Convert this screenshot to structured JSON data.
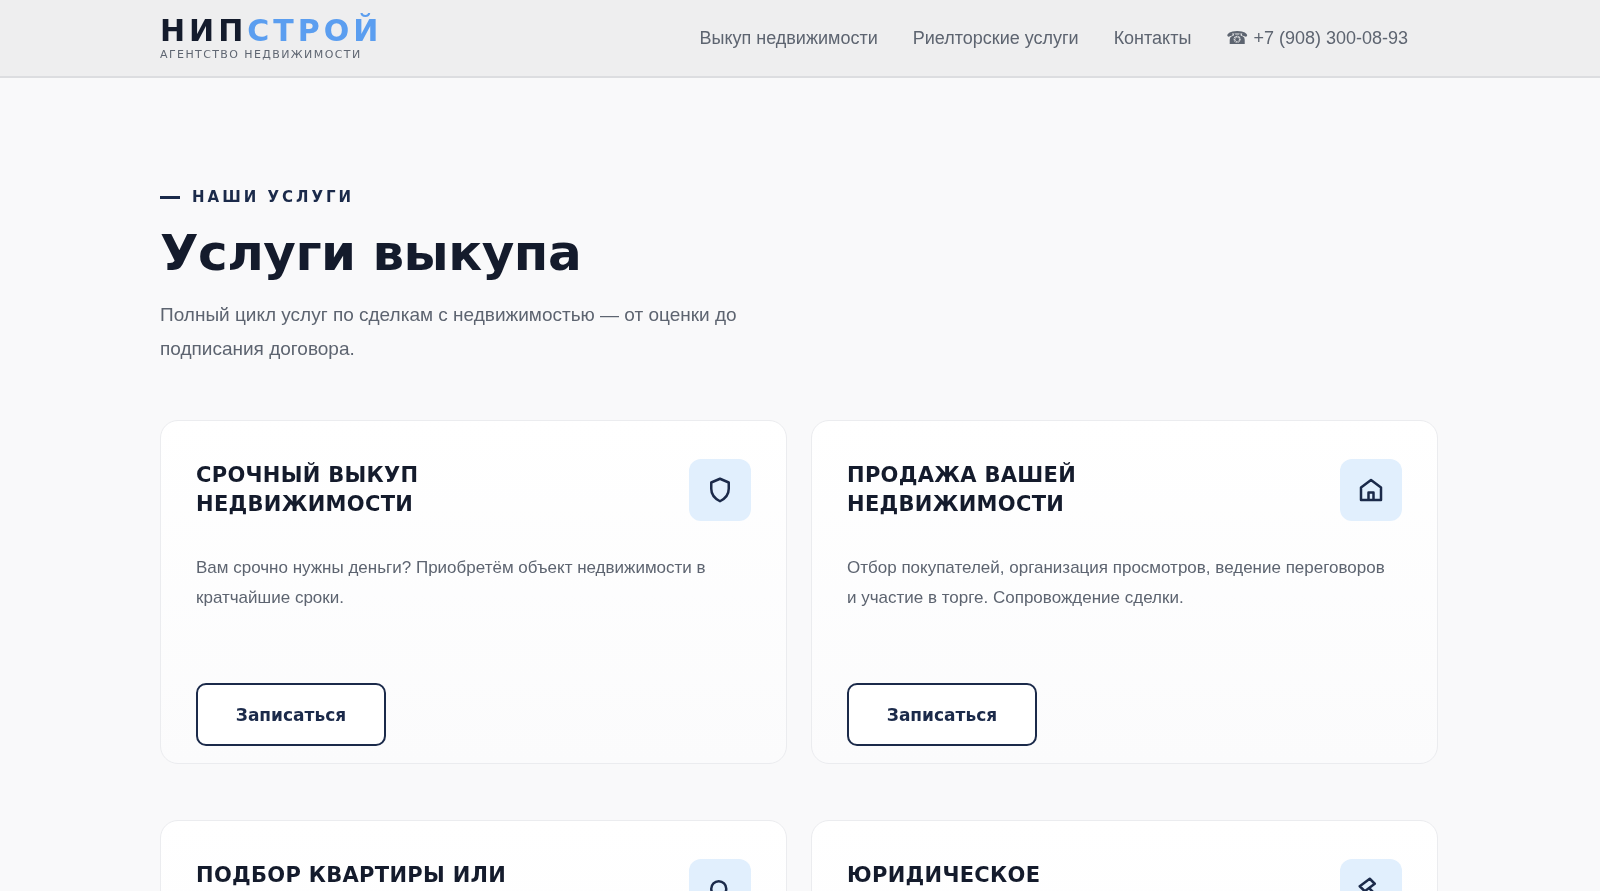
{
  "header": {
    "logo": {
      "dark": "НИП",
      "accent": "СТРОЙ",
      "tagline": "АГЕНТСТВО НЕДВИЖИМОСТИ"
    },
    "nav": [
      "Выкуп недвижимости",
      "Риелторские услуги",
      "Контакты"
    ],
    "phone": {
      "icon": "☎",
      "number": "+7 (908) 300-08-93"
    }
  },
  "section": {
    "eyebrow": "НАШИ УСЛУГИ",
    "title": "Услуги выкупа",
    "description": "Полный цикл услуг по сделкам с недвижимостью — от оценки до подписания договора."
  },
  "cards": [
    {
      "title": "СРОЧНЫЙ ВЫКУП НЕДВИЖИМОСТИ",
      "description": "Вам срочно нужны деньги? Приобретём объект недвижимости в кратчайшие сроки.",
      "button": "Записаться"
    },
    {
      "title": "ПРОДАЖА ВАШЕЙ НЕДВИЖИМОСТИ",
      "description": "Отбор покупателей, организация просмотров, ведение переговоров и участие в торге. Сопровождение сделки.",
      "button": "Записаться"
    },
    {
      "title": "ПОДБОР КВАРТИРЫ ИЛИ"
    },
    {
      "title": "ЮРИДИЧЕСКОЕ"
    }
  ]
}
